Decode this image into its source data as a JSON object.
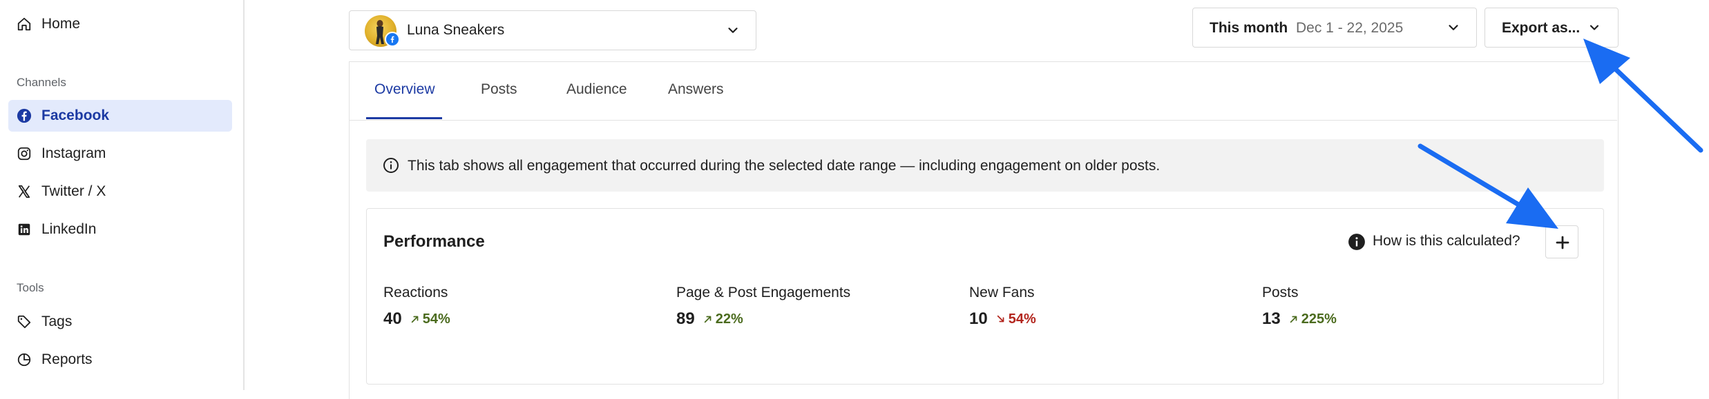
{
  "sidebar": {
    "home_label": "Home",
    "channels_heading": "Channels",
    "channels": [
      {
        "label": "Facebook",
        "icon": "facebook-icon",
        "active": true
      },
      {
        "label": "Instagram",
        "icon": "instagram-icon",
        "active": false
      },
      {
        "label": "Twitter / X",
        "icon": "x-icon",
        "active": false
      },
      {
        "label": "LinkedIn",
        "icon": "linkedin-icon",
        "active": false
      }
    ],
    "tools_heading": "Tools",
    "tools": [
      {
        "label": "Tags",
        "icon": "tag-icon"
      },
      {
        "label": "Reports",
        "icon": "pie-chart-icon"
      }
    ]
  },
  "header": {
    "account_name": "Luna Sneakers",
    "date_range_label": "This month",
    "date_range_value": "Dec 1 - 22, 2025",
    "export_label": "Export as..."
  },
  "tabs": [
    {
      "label": "Overview",
      "active": true
    },
    {
      "label": "Posts",
      "active": false
    },
    {
      "label": "Audience",
      "active": false
    },
    {
      "label": "Answers",
      "active": false
    }
  ],
  "info_banner": {
    "text": "This tab shows all engagement that occurred during the selected date range — including engagement on older posts."
  },
  "performance": {
    "title": "Performance",
    "calc_link": "How is this calculated?",
    "metrics": [
      {
        "label": "Reactions",
        "value": "40",
        "delta": "54%",
        "direction": "up"
      },
      {
        "label": "Page & Post Engagements",
        "value": "89",
        "delta": "22%",
        "direction": "up"
      },
      {
        "label": "New Fans",
        "value": "10",
        "delta": "54%",
        "direction": "down"
      },
      {
        "label": "Posts",
        "value": "13",
        "delta": "225%",
        "direction": "up"
      }
    ]
  },
  "colors": {
    "accent": "#1c3aa3",
    "active_bg": "#e3eafc",
    "positive": "#4b6b1e",
    "negative": "#b3261e",
    "annotation_arrow": "#1a6cf2"
  }
}
